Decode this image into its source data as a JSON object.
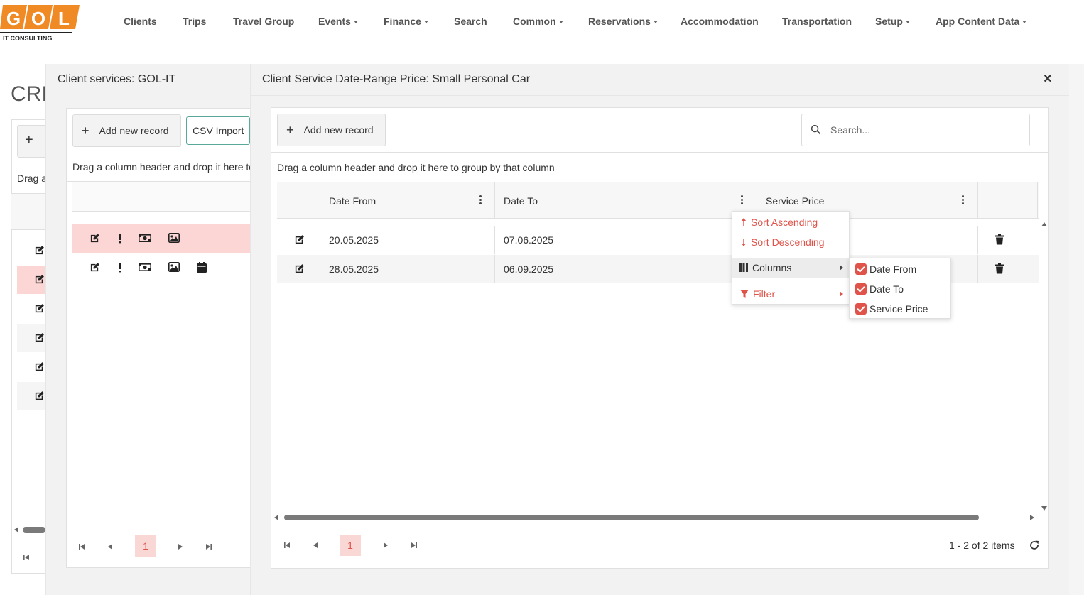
{
  "brand": {
    "logo_letters": [
      "G",
      "O",
      "L"
    ],
    "logo_subtitle": "IT CONSULTING",
    "accent": "#f08a24"
  },
  "nav": {
    "items": [
      {
        "label": "Clients",
        "dropdown": false
      },
      {
        "label": "Trips",
        "dropdown": false
      },
      {
        "label": "Travel Group",
        "dropdown": false
      },
      {
        "label": "Events",
        "dropdown": true
      },
      {
        "label": "Finance",
        "dropdown": true
      },
      {
        "label": "Search",
        "dropdown": false
      },
      {
        "label": "Common",
        "dropdown": true
      },
      {
        "label": "Reservations",
        "dropdown": true
      },
      {
        "label": "Accommodation",
        "dropdown": false
      },
      {
        "label": "Transportation",
        "dropdown": false
      },
      {
        "label": "Setup",
        "dropdown": true
      },
      {
        "label": "App Content Data",
        "dropdown": true
      }
    ]
  },
  "background": {
    "page_title": "CRI",
    "add_symbol": "+",
    "drag_text": "Drag a"
  },
  "left_window": {
    "title": "Client services: GOL-IT",
    "add_button": "Add new record",
    "csv_button": "CSV Import",
    "drag_text": "Drag a column header and drop it here to",
    "current_page": "1",
    "highlight_color": "#fbd6d4"
  },
  "right_window": {
    "title": "Client Service Date-Range Price: Small Personal Car",
    "close_label": "×",
    "add_button": "Add new record",
    "search_placeholder": "Search...",
    "drag_text": "Drag a column header and drop it here to group by that column",
    "columns": [
      "Date From",
      "Date To",
      "Service Price"
    ],
    "rows": [
      {
        "date_from": "20.05.2025",
        "date_to": "07.06.2025",
        "service_price": ""
      },
      {
        "date_from": "28.05.2025",
        "date_to": "06.09.2025",
        "service_price": ""
      }
    ],
    "current_page": "1",
    "pager_info": "1 - 2 of 2 items"
  },
  "column_menu": {
    "sort_ascending": "Sort Ascending",
    "sort_descending": "Sort Descending",
    "columns": "Columns",
    "filter": "Filter",
    "submenu_items": [
      {
        "label": "Date From",
        "checked": true
      },
      {
        "label": "Date To",
        "checked": true
      },
      {
        "label": "Service Price",
        "checked": true
      }
    ],
    "accent_color": "#e0534a"
  }
}
